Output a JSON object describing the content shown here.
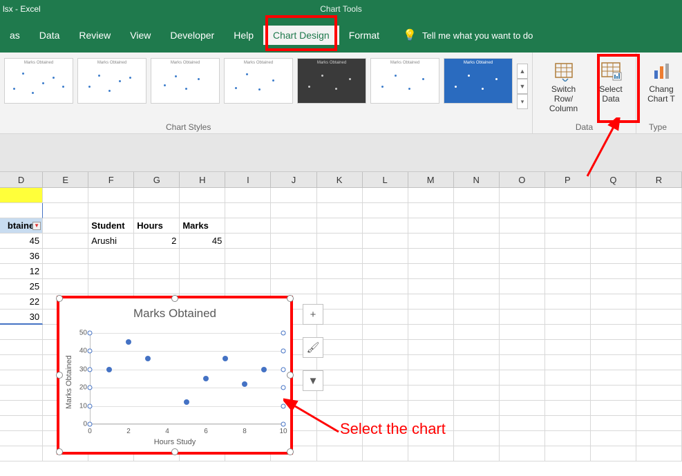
{
  "titlebar": {
    "app_title": "lsx - Excel",
    "chart_tools": "Chart Tools"
  },
  "tabs": {
    "t0": "as",
    "t1": "Data",
    "t2": "Review",
    "t3": "View",
    "t4": "Developer",
    "t5": "Help",
    "t6": "Chart Design",
    "t7": "Format",
    "tellme": "Tell me what you want to do"
  },
  "ribbon": {
    "styles_label": "Chart Styles",
    "switch_line1": "Switch Row/",
    "switch_line2": "Column",
    "select_line1": "Select",
    "select_line2": "Data",
    "data_label": "Data",
    "change_line1": "Chang",
    "change_line2": "Chart T",
    "type_label": "Type",
    "thumb_title": "Marks Obtained"
  },
  "columns": {
    "D": "D",
    "E": "E",
    "F": "F",
    "G": "G",
    "H": "H",
    "I": "I",
    "J": "J",
    "K": "K",
    "L": "L",
    "M": "M",
    "N": "N",
    "O": "O",
    "P": "P",
    "Q": "Q",
    "R": "R"
  },
  "sheet": {
    "d_header": "btained",
    "d_vals": [
      "45",
      "36",
      "12",
      "25",
      "22",
      "30"
    ],
    "f_header": "Student",
    "g_header": "Hours",
    "h_header": "Marks",
    "f_val": "Arushi",
    "g_val": "2",
    "h_val": "45"
  },
  "chart_data": {
    "type": "scatter",
    "title": "Marks Obtained",
    "xlabel": "Hours Study",
    "ylabel": "Marks Obtained",
    "xlim": [
      0,
      10
    ],
    "ylim": [
      0,
      50
    ],
    "xticks": [
      0,
      2,
      4,
      6,
      8,
      10
    ],
    "yticks": [
      0,
      10,
      20,
      30,
      40,
      50
    ],
    "series": [
      {
        "name": "Marks",
        "points": [
          {
            "x": 1,
            "y": 30
          },
          {
            "x": 2,
            "y": 45
          },
          {
            "x": 3,
            "y": 36
          },
          {
            "x": 5,
            "y": 12
          },
          {
            "x": 6,
            "y": 25
          },
          {
            "x": 8,
            "y": 22
          },
          {
            "x": 7,
            "y": 36
          },
          {
            "x": 9,
            "y": 30
          }
        ]
      }
    ]
  },
  "side_btns": {
    "plus": "+",
    "brush": "🖌",
    "filter": "⧩"
  },
  "annotation": {
    "select_chart": "Select the chart"
  }
}
